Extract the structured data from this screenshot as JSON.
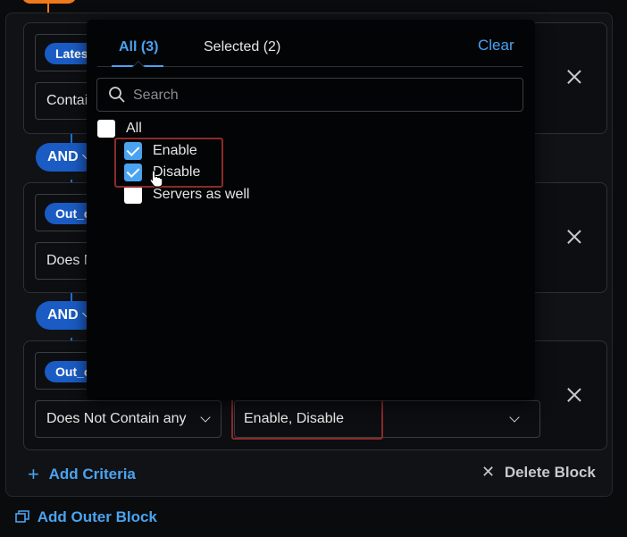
{
  "overlay": {
    "tabs": [
      {
        "label": "All (3)",
        "active": true
      },
      {
        "label": "Selected (2)",
        "active": false
      }
    ],
    "clear_label": "Clear",
    "search_placeholder": "Search",
    "options": [
      {
        "label": "All",
        "checked": false
      },
      {
        "label": "Enable",
        "checked": true
      },
      {
        "label": "Disable",
        "checked": true
      },
      {
        "label": "Servers as well",
        "checked": false
      }
    ]
  },
  "blocks": [
    {
      "tag": "Latest",
      "operator": "Contain"
    },
    {
      "tag": "Out_of",
      "operator": "Does N"
    },
    {
      "tag": "Out_of",
      "operator": "Does Not Contain any",
      "value": "Enable, Disable"
    }
  ],
  "connectors": [
    "AND",
    "AND"
  ],
  "footer": {
    "add_criteria": "Add Criteria",
    "delete_block": "Delete Block",
    "add_outer_block": "Add Outer Block"
  },
  "colors": {
    "accent": "#4aa3f0",
    "tag_blue": "#1a5bc4",
    "highlight_frame": "#8c2a2a",
    "orange": "#f07a1a"
  }
}
